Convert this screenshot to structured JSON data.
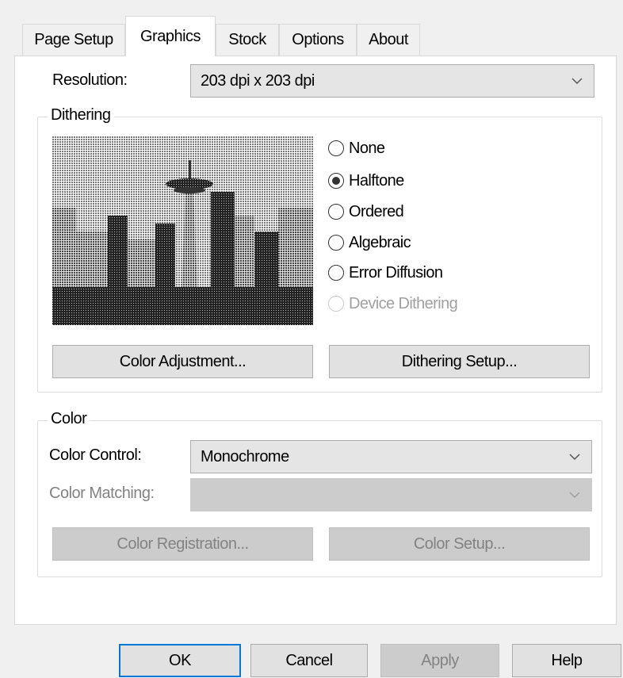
{
  "tabs": [
    {
      "label": "Page Setup"
    },
    {
      "label": "Graphics"
    },
    {
      "label": "Stock"
    },
    {
      "label": "Options"
    },
    {
      "label": "About"
    }
  ],
  "resolution": {
    "label": "Resolution:",
    "value": "203 dpi x 203 dpi"
  },
  "dithering": {
    "group_label": "Dithering",
    "options": [
      {
        "label": "None"
      },
      {
        "label": "Halftone"
      },
      {
        "label": "Ordered"
      },
      {
        "label": "Algebraic"
      },
      {
        "label": "Error Diffusion"
      },
      {
        "label": "Device Dithering"
      }
    ],
    "selected": "Halftone",
    "color_adjustment_button": "Color Adjustment...",
    "dithering_setup_button": "Dithering Setup..."
  },
  "color": {
    "group_label": "Color",
    "control_label": "Color Control:",
    "control_value": "Monochrome",
    "matching_label": "Color Matching:",
    "matching_value": "",
    "registration_button": "Color Registration...",
    "setup_button": "Color Setup..."
  },
  "footer": {
    "ok": "OK",
    "cancel": "Cancel",
    "apply": "Apply",
    "help": "Help"
  },
  "colors": {
    "focus_border": "#0078d7",
    "disabled_text": "#838383"
  }
}
